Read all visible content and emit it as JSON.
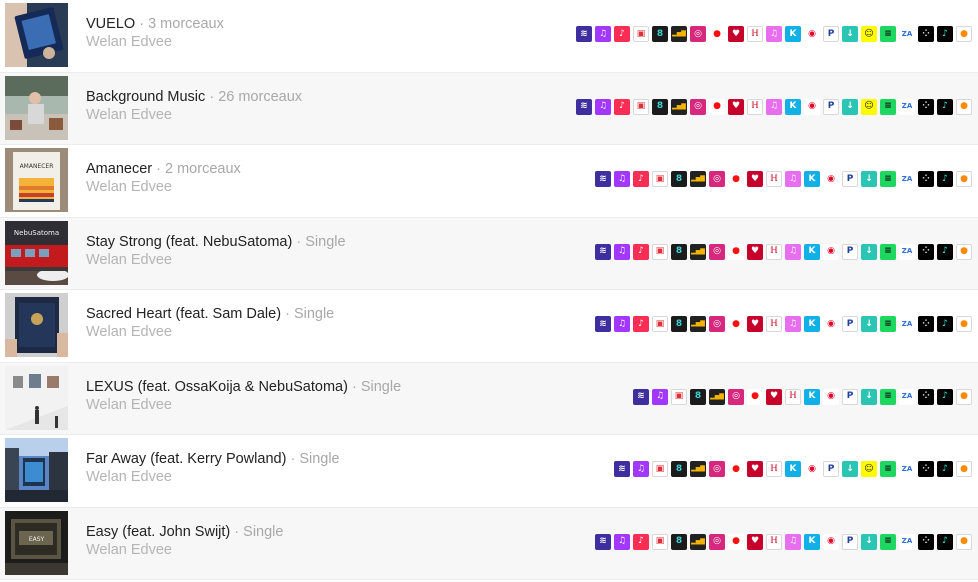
{
  "separator": "·",
  "artist": "Welan Edvee",
  "releases": [
    {
      "title": "VUELO",
      "count": "3 morceaux",
      "cover": "vuelo",
      "services": [
        "amazon-music",
        "deezer",
        "apple-music",
        "napster",
        "audiomack",
        "tidal-beat",
        "instagram",
        "youtube-music",
        "iheartradio",
        "kkbox-eq",
        "itunes",
        "kkbox",
        "netease",
        "pandora",
        "jiosaavn",
        "snapchat",
        "spotify",
        "anghami",
        "qobuz-tidal",
        "tiktok",
        "boomplay"
      ]
    },
    {
      "title": "Background Music",
      "count": "26 morceaux",
      "cover": "background",
      "services": [
        "amazon-music",
        "deezer",
        "apple-music",
        "napster",
        "audiomack",
        "tidal-beat",
        "instagram",
        "youtube-music",
        "iheartradio",
        "kkbox-eq",
        "itunes",
        "kkbox",
        "netease",
        "pandora",
        "jiosaavn",
        "snapchat",
        "spotify",
        "anghami",
        "qobuz-tidal",
        "tiktok",
        "boomplay"
      ]
    },
    {
      "title": "Amanecer",
      "count": "2 morceaux",
      "cover": "amanecer",
      "cover_text": "AMANECER",
      "services": [
        "amazon-music",
        "deezer",
        "apple-music",
        "napster",
        "audiomack",
        "tidal-beat",
        "instagram",
        "youtube-music",
        "iheartradio",
        "kkbox-eq",
        "itunes",
        "kkbox",
        "netease",
        "pandora",
        "jiosaavn",
        "spotify",
        "anghami",
        "qobuz-tidal",
        "tiktok",
        "boomplay"
      ]
    },
    {
      "title": "Stay Strong (feat. NebuSatoma)",
      "count": "Single",
      "cover": "staystrong",
      "cover_text": "NebuSatoma",
      "services": [
        "amazon-music",
        "deezer",
        "apple-music",
        "napster",
        "audiomack",
        "tidal-beat",
        "instagram",
        "youtube-music",
        "iheartradio",
        "kkbox-eq",
        "itunes",
        "kkbox",
        "netease",
        "pandora",
        "jiosaavn",
        "spotify",
        "anghami",
        "qobuz-tidal",
        "tiktok",
        "boomplay"
      ]
    },
    {
      "title": "Sacred Heart (feat. Sam Dale)",
      "count": "Single",
      "cover": "sacred",
      "services": [
        "amazon-music",
        "deezer",
        "apple-music",
        "napster",
        "audiomack",
        "tidal-beat",
        "instagram",
        "youtube-music",
        "iheartradio",
        "kkbox-eq",
        "itunes",
        "kkbox",
        "netease",
        "pandora",
        "jiosaavn",
        "spotify",
        "anghami",
        "qobuz-tidal",
        "tiktok",
        "boomplay"
      ]
    },
    {
      "title": "LEXUS (feat. OssaKoija & NebuSatoma)",
      "count": "Single",
      "cover": "lexus",
      "services": [
        "amazon-music",
        "deezer",
        "napster",
        "audiomack",
        "tidal-beat",
        "instagram",
        "youtube-music",
        "iheartradio",
        "kkbox-eq",
        "kkbox",
        "netease",
        "pandora",
        "jiosaavn",
        "spotify",
        "anghami",
        "qobuz-tidal",
        "tiktok",
        "boomplay"
      ]
    },
    {
      "title": "Far Away (feat. Kerry Powland)",
      "count": "Single",
      "cover": "faraway",
      "services": [
        "amazon-music",
        "deezer",
        "napster",
        "audiomack",
        "tidal-beat",
        "instagram",
        "youtube-music",
        "iheartradio",
        "kkbox-eq",
        "kkbox",
        "netease",
        "pandora",
        "jiosaavn",
        "snapchat",
        "spotify",
        "anghami",
        "qobuz-tidal",
        "tiktok",
        "boomplay"
      ]
    },
    {
      "title": "Easy (feat. John Swijt)",
      "count": "Single",
      "cover": "easy",
      "cover_text": "EASY",
      "services": [
        "amazon-music",
        "deezer",
        "apple-music",
        "napster",
        "audiomack",
        "tidal-beat",
        "instagram",
        "youtube-music",
        "iheartradio",
        "kkbox-eq",
        "itunes",
        "kkbox",
        "netease",
        "pandora",
        "jiosaavn",
        "spotify",
        "anghami",
        "qobuz-tidal",
        "tiktok",
        "boomplay"
      ]
    }
  ],
  "service_styles": {
    "amazon-music": {
      "bg": "#3f2f9e",
      "glyph": "≋",
      "outline": false,
      "fg": "#ffffff"
    },
    "deezer": {
      "bg": "#a238ff",
      "glyph": "♫",
      "outline": false,
      "fg": "#ffffff"
    },
    "apple-music": {
      "bg": "#fa2d55",
      "glyph": "♪",
      "outline": false,
      "fg": "#ffffff"
    },
    "napster": {
      "bg": "#ffffff",
      "glyph": "▣",
      "outline": true,
      "fg": "#e0303a"
    },
    "audiomack": {
      "bg": "#1b1b1b",
      "glyph": "8",
      "outline": false,
      "fg": "#3ad0d6"
    },
    "tidal-beat": {
      "bg": "#222222",
      "glyph": "▂▅▇",
      "outline": false,
      "fg": "#f5b400"
    },
    "instagram": {
      "bg": "#d6287d",
      "glyph": "◎",
      "outline": false,
      "fg": "#ffffff"
    },
    "youtube-music": {
      "bg": "#ffffff",
      "glyph": "●",
      "outline": false,
      "fg": "#ff1010"
    },
    "iheartradio": {
      "bg": "#c6002b",
      "glyph": "♥",
      "outline": false,
      "fg": "#ffffff"
    },
    "kkbox-eq": {
      "bg": "#ffffff",
      "glyph": "ℍ",
      "outline": true,
      "fg": "#c8102e"
    },
    "itunes": {
      "bg": "#e86ef0",
      "glyph": "♫",
      "outline": false,
      "fg": "#ffffff"
    },
    "kkbox": {
      "bg": "#11b1e8",
      "glyph": "K",
      "outline": false,
      "fg": "#ffffff"
    },
    "netease": {
      "bg": "#ffffff",
      "glyph": "◉",
      "outline": false,
      "fg": "#e60026"
    },
    "pandora": {
      "bg": "#ffffff",
      "glyph": "P",
      "outline": true,
      "fg": "#224099"
    },
    "jiosaavn": {
      "bg": "#2bc5b4",
      "glyph": "↓",
      "outline": false,
      "fg": "#ffffff"
    },
    "snapchat": {
      "bg": "#fffc00",
      "glyph": "☺",
      "outline": false,
      "fg": "#222222"
    },
    "spotify": {
      "bg": "#1ed760",
      "glyph": "≡",
      "outline": false,
      "fg": "#111111"
    },
    "anghami": {
      "bg": "#ffffff",
      "glyph": "ZA",
      "outline": false,
      "fg": "#2f6fd6"
    },
    "qobuz-tidal": {
      "bg": "#000000",
      "glyph": "⁘",
      "outline": false,
      "fg": "#ffffff"
    },
    "tiktok": {
      "bg": "#010101",
      "glyph": "♪",
      "outline": false,
      "fg": "#25f4ee"
    },
    "boomplay": {
      "bg": "#ffffff",
      "glyph": "●",
      "outline": true,
      "fg": "#ff8a00"
    }
  }
}
